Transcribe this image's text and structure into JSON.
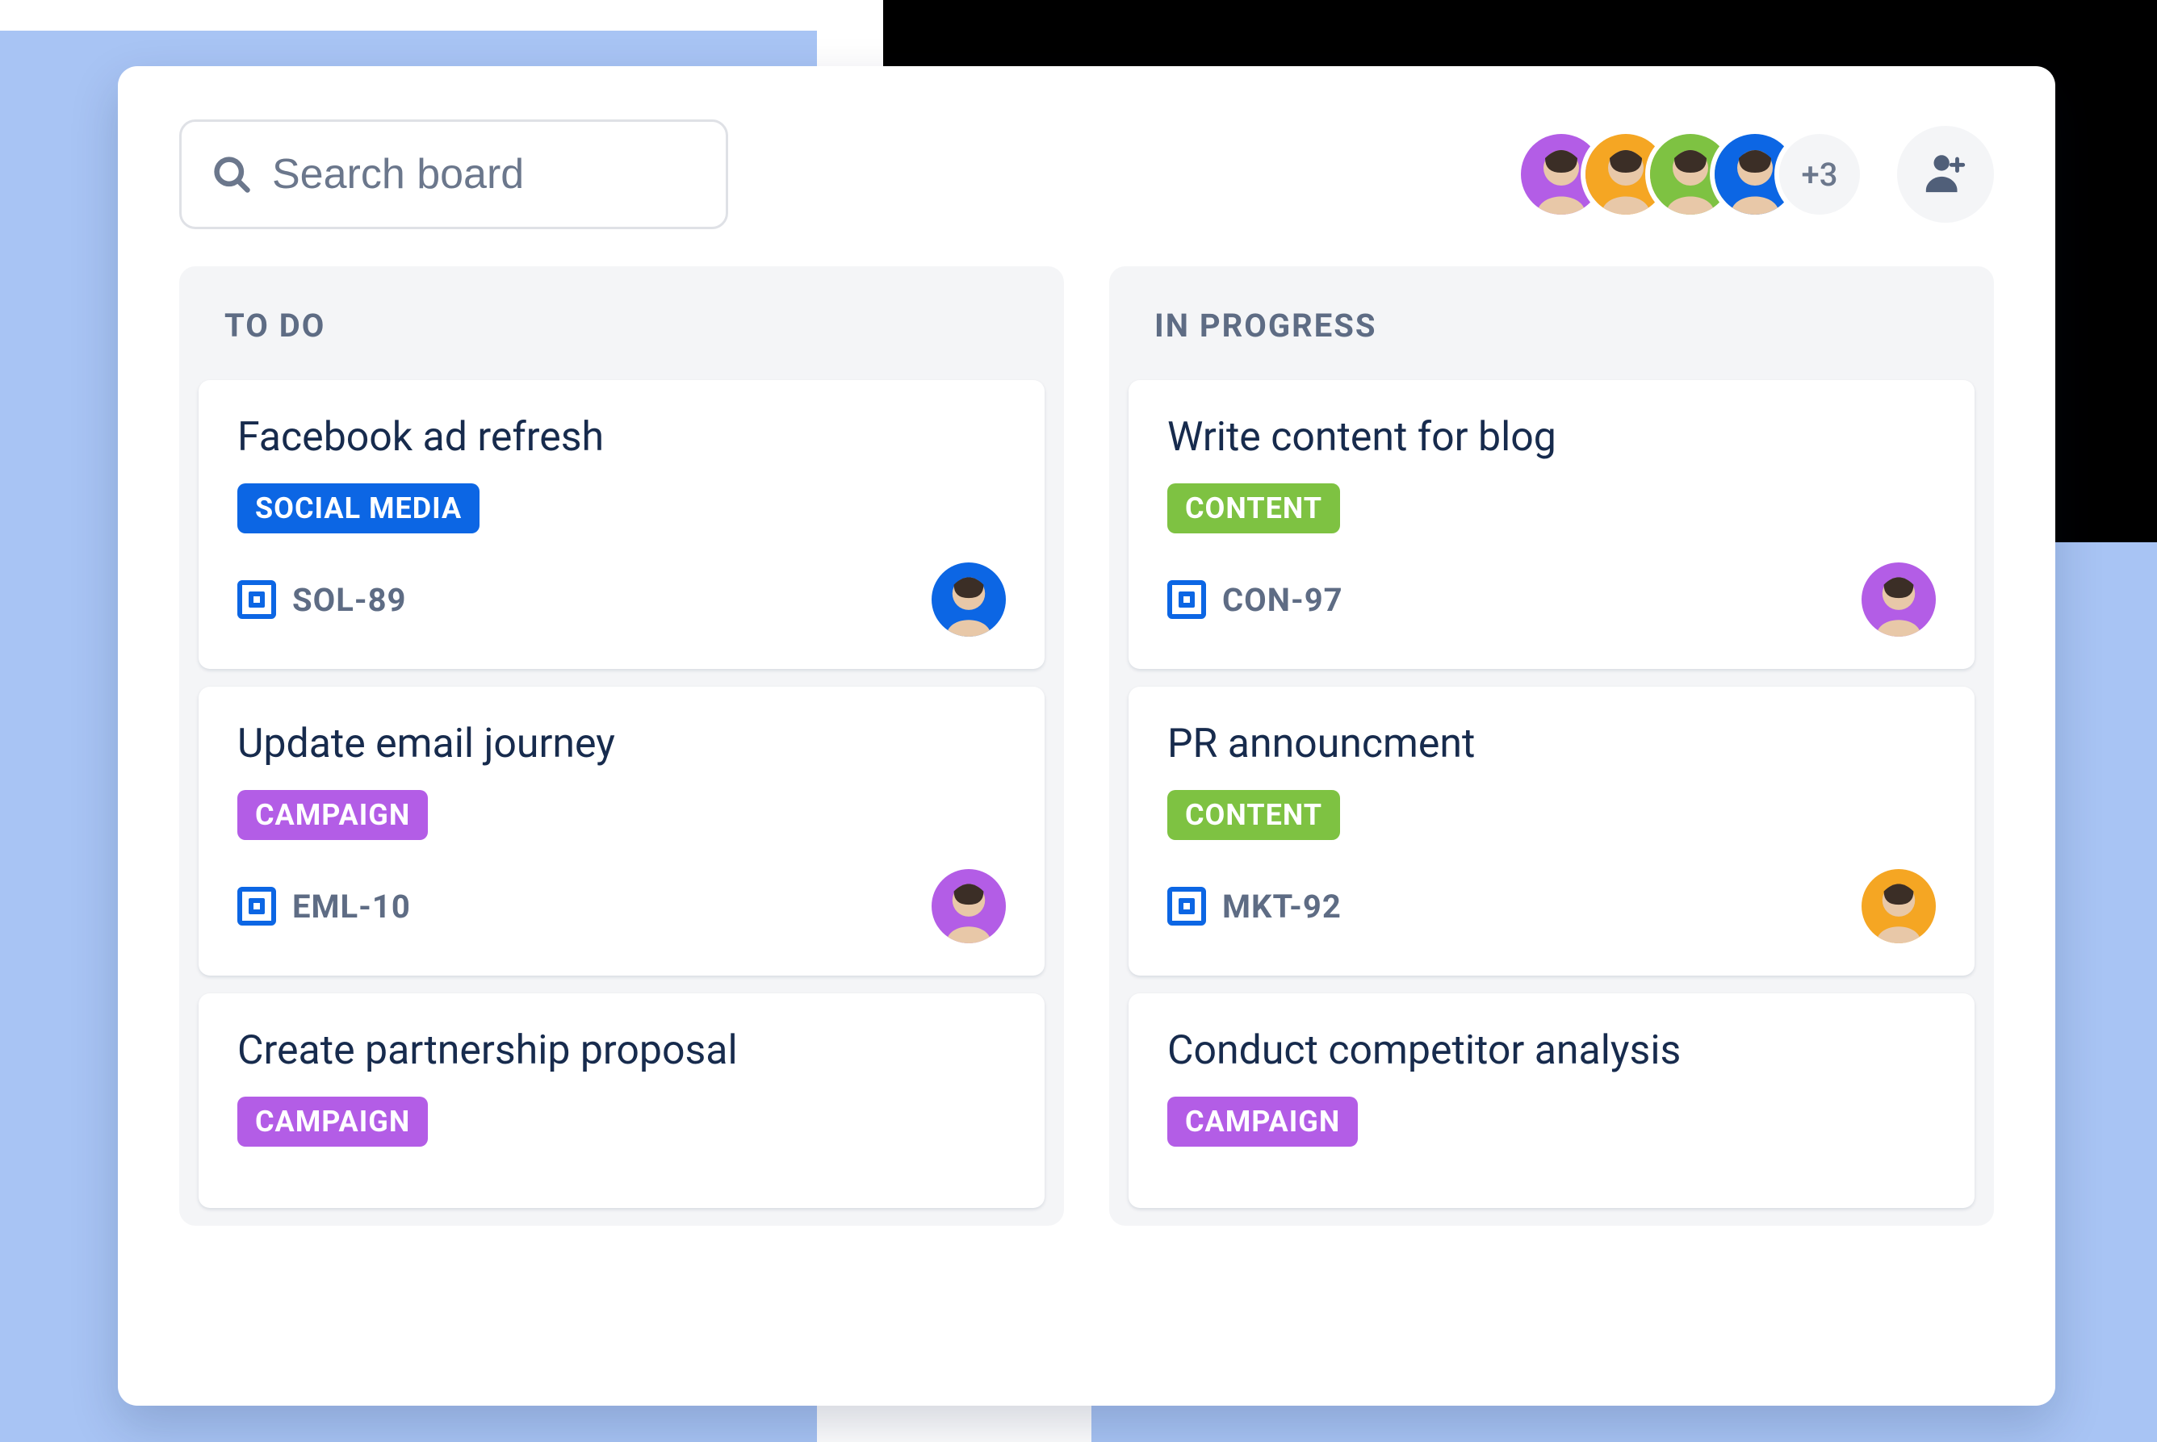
{
  "search": {
    "placeholder": "Search board"
  },
  "avatar_overflow": "+3",
  "avatar_colors": [
    "#B35DE6",
    "#F5A623",
    "#7EC242",
    "#0C66E4"
  ],
  "columns": [
    {
      "title": "TO DO",
      "cards": [
        {
          "title": "Facebook ad refresh",
          "chip": {
            "label": "SOCIAL MEDIA",
            "color": "#0C66E4"
          },
          "key": "SOL-89",
          "avatar_color": "#0C66E4"
        },
        {
          "title": "Update email journey",
          "chip": {
            "label": "CAMPAIGN",
            "color": "#B35DE6"
          },
          "key": "EML-10",
          "avatar_color": "#B35DE6"
        },
        {
          "title": "Create partnership proposal",
          "chip": {
            "label": "CAMPAIGN",
            "color": "#B35DE6"
          },
          "key": "",
          "avatar_color": ""
        }
      ]
    },
    {
      "title": "IN PROGRESS",
      "cards": [
        {
          "title": "Write content for blog",
          "chip": {
            "label": "CONTENT",
            "color": "#7EC242"
          },
          "key": "CON-97",
          "avatar_color": "#B35DE6"
        },
        {
          "title": "PR announcment",
          "chip": {
            "label": "CONTENT",
            "color": "#7EC242"
          },
          "key": "MKT-92",
          "avatar_color": "#F5A623"
        },
        {
          "title": "Conduct competitor analysis",
          "chip": {
            "label": "CAMPAIGN",
            "color": "#B35DE6"
          },
          "key": "",
          "avatar_color": ""
        }
      ]
    }
  ]
}
